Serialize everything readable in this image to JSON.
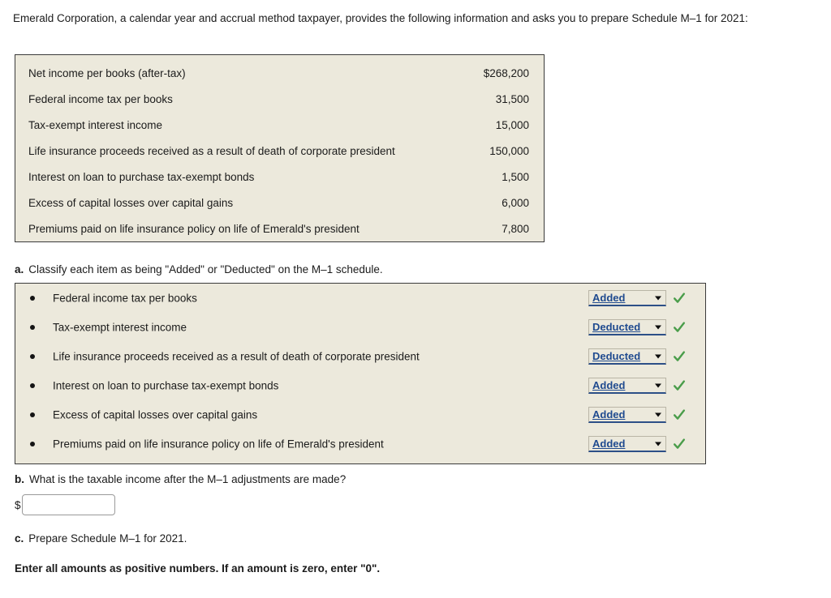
{
  "intro": "Emerald Corporation, a calendar year and accrual method taxpayer, provides the following information and asks you to prepare Schedule M–1 for 2021:",
  "colors": {
    "panel_bg": "#ece9dc",
    "panel_border": "#3a3a3a",
    "select_text": "#1f4a8f",
    "select_underline": "#2c4f87",
    "check_green": "#4a9d4a",
    "page_bg": "#ffffff"
  },
  "facts_table": {
    "rows": [
      {
        "label": "Net income per books (after-tax)",
        "amount": "$268,200"
      },
      {
        "label": "Federal income tax per books",
        "amount": "31,500"
      },
      {
        "label": "Tax-exempt interest income",
        "amount": "15,000"
      },
      {
        "label": "Life insurance proceeds received as a result of death of corporate president",
        "amount": "150,000"
      },
      {
        "label": "Interest on loan to purchase tax-exempt bonds",
        "amount": "1,500"
      },
      {
        "label": "Excess of capital losses over capital gains",
        "amount": "6,000"
      },
      {
        "label": "Premiums paid on life insurance policy on life of Emerald's president",
        "amount": "7,800"
      }
    ]
  },
  "part_a": {
    "marker": "a.",
    "prompt": "Classify each item as being \"Added\" or \"Deducted\" on the M–1 schedule.",
    "select_options": [
      "Added",
      "Deducted"
    ],
    "items": [
      {
        "label": "Federal income tax per books",
        "selection": "Added",
        "status": "correct"
      },
      {
        "label": "Tax-exempt interest income",
        "selection": "Deducted",
        "status": "correct"
      },
      {
        "label": "Life insurance proceeds received as a result of death of corporate president",
        "selection": "Deducted",
        "status": "correct"
      },
      {
        "label": "Interest on loan to purchase tax-exempt bonds",
        "selection": "Added",
        "status": "correct"
      },
      {
        "label": "Excess of capital losses over capital gains",
        "selection": "Added",
        "status": "correct"
      },
      {
        "label": "Premiums paid on life insurance policy on life of Emerald's president",
        "selection": "Added",
        "status": "correct"
      }
    ]
  },
  "part_b": {
    "marker": "b.",
    "prompt": "What is the taxable income after the M–1 adjustments are made?",
    "currency_symbol": "$",
    "answer_value": "",
    "answer_placeholder": ""
  },
  "part_c": {
    "marker": "c.",
    "prompt": "Prepare Schedule M–1 for 2021."
  },
  "note": "Enter all amounts as positive numbers. If an amount is zero, enter \"0\"."
}
